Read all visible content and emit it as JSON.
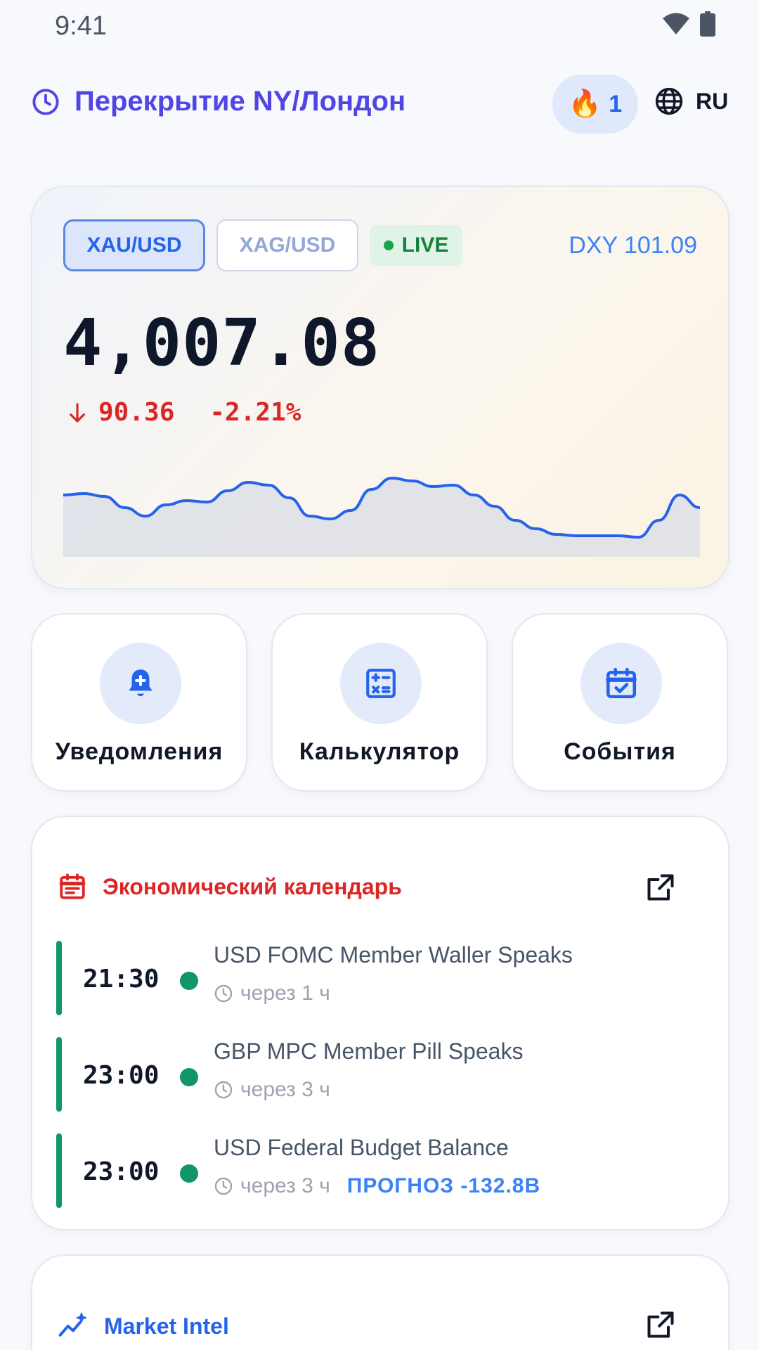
{
  "status_bar": {
    "time": "9:41"
  },
  "header": {
    "session_title": "Перекрытие NY/Лондон",
    "streak_count": "1",
    "language": "RU"
  },
  "price_card": {
    "pairs": [
      {
        "label": "XAU/USD",
        "active": true
      },
      {
        "label": "XAG/USD",
        "active": false
      }
    ],
    "live_label": "LIVE",
    "dxy": "DXY 101.09",
    "price": "4,007.08",
    "change": "90.36",
    "change_pct": "-2.21%",
    "sparkline": [
      68,
      66,
      70,
      86,
      98,
      82,
      76,
      78,
      62,
      50,
      54,
      72,
      98,
      102,
      90,
      60,
      44,
      48,
      56,
      54,
      68,
      84,
      104,
      116,
      124,
      126,
      126,
      126,
      128,
      104,
      68,
      86
    ]
  },
  "tiles": [
    {
      "label": "Уведомления",
      "icon": "bell-plus-icon"
    },
    {
      "label": "Калькулятор",
      "icon": "calculator-icon"
    },
    {
      "label": "События",
      "icon": "calendar-check-icon"
    }
  ],
  "calendar": {
    "title": "Экономический календарь",
    "events": [
      {
        "time": "21:30",
        "name": "USD FOMC Member Waller Speaks",
        "eta": "через 1 ч",
        "forecast": ""
      },
      {
        "time": "23:00",
        "name": "GBP MPC Member Pill Speaks",
        "eta": "через 3 ч",
        "forecast": ""
      },
      {
        "time": "23:00",
        "name": "USD Federal Budget Balance",
        "eta": "через 3 ч",
        "forecast": "ПРОГНОЗ -132.8B"
      }
    ]
  },
  "market_intel": {
    "title": "Market Intel"
  },
  "colors": {
    "accent": "#2563eb",
    "session": "#4f46e5",
    "negative": "#dc2626",
    "positive": "#10966a"
  }
}
